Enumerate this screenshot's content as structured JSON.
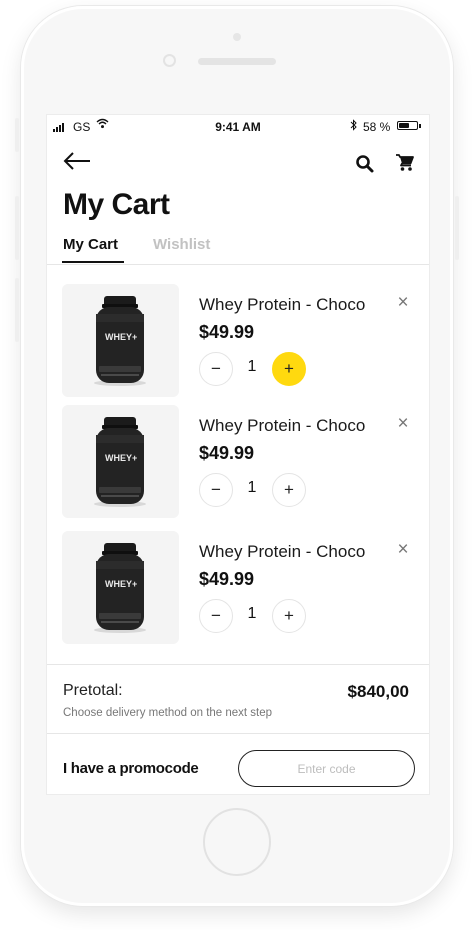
{
  "status_bar": {
    "carrier": "GS",
    "time": "9:41 AM",
    "battery": "58 %",
    "battery_level": 0.58
  },
  "header": {
    "title": "My Cart"
  },
  "tabs": [
    {
      "label": "My Cart",
      "active": true
    },
    {
      "label": "Wishlist",
      "active": false
    }
  ],
  "cart": {
    "items": [
      {
        "name": "Whey Protein - Choco",
        "price": "$49.99",
        "quantity": "1",
        "product_label": "WHEY+"
      },
      {
        "name": "Whey Protein - Choco",
        "price": "$49.99",
        "quantity": "1",
        "product_label": "WHEY+"
      },
      {
        "name": "Whey Protein - Choco",
        "price": "$49.99",
        "quantity": "1",
        "product_label": "WHEY+"
      }
    ],
    "minus_symbol": "−",
    "plus_symbol": "+",
    "remove_symbol": "×"
  },
  "summary": {
    "pretotal_label": "Pretotal:",
    "pretotal_value": "$840,00",
    "delivery_note": "Choose delivery method on the next step"
  },
  "promo": {
    "label": "I have a promocode",
    "placeholder": "Enter code"
  },
  "colors": {
    "accent": "#ffd90f",
    "text": "#111111",
    "inactive_tab": "#c2c2c2"
  },
  "icons": [
    "back-arrow-icon",
    "search-icon",
    "cart-icon",
    "close-icon",
    "minus-icon",
    "plus-icon",
    "wifi-icon",
    "bluetooth-icon",
    "battery-icon",
    "signal-icon"
  ]
}
